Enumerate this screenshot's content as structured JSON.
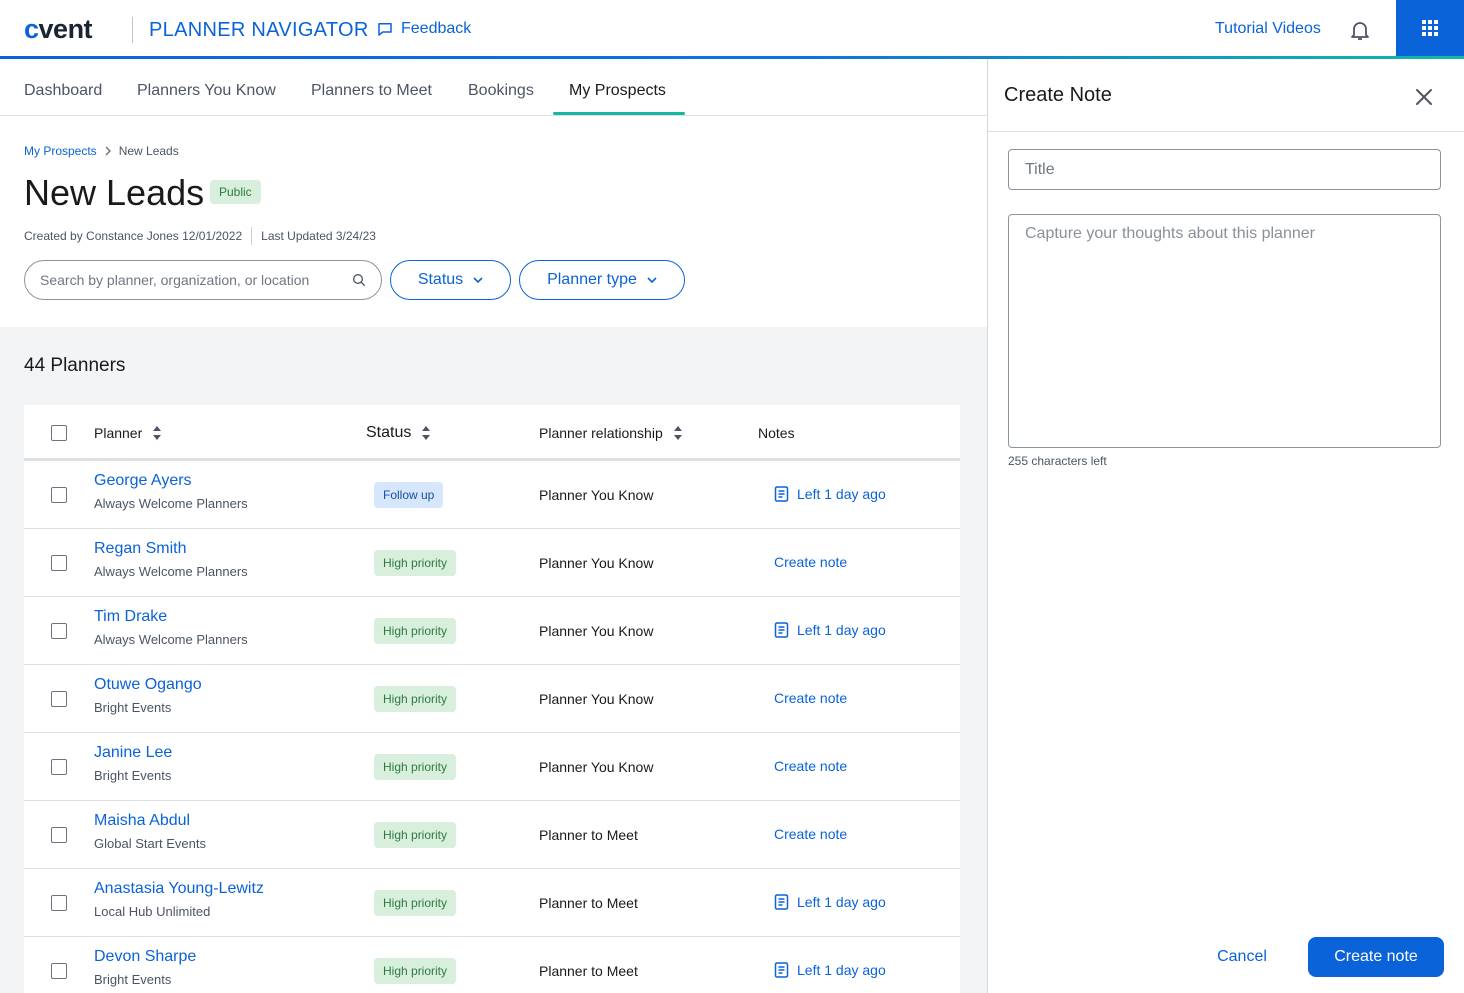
{
  "header": {
    "logo": "cvent",
    "app_title": "PLANNER NAVIGATOR",
    "feedback": "Feedback",
    "tutorial": "Tutorial Videos"
  },
  "tabs": [
    "Dashboard",
    "Planners You Know",
    "Planners to Meet",
    "Bookings",
    "My Prospects"
  ],
  "active_tab": "My Prospects",
  "breadcrumb": {
    "parent": "My Prospects",
    "current": "New Leads"
  },
  "page": {
    "title": "New Leads",
    "badge": "Public",
    "created": "Created by Constance Jones 12/01/2022",
    "updated": "Last Updated 3/24/23"
  },
  "filters": {
    "search_placeholder": "Search by planner, organization, or location",
    "status": "Status",
    "planner_type": "Planner type"
  },
  "list": {
    "count": "44 Planners",
    "columns": {
      "planner": "Planner",
      "status": "Status",
      "relationship": "Planner relationship",
      "notes": "Notes"
    },
    "rows": [
      {
        "name": "George Ayers",
        "org": "Always Welcome Planners",
        "status": "Follow up",
        "relationship": "Planner You Know",
        "note": "Left 1 day ago"
      },
      {
        "name": "Regan Smith",
        "org": "Always Welcome Planners",
        "status": "High priority",
        "relationship": "Planner You Know",
        "note": "Create note"
      },
      {
        "name": "Tim Drake",
        "org": "Always Welcome Planners",
        "status": "High priority",
        "relationship": "Planner You Know",
        "note": "Left 1 day ago"
      },
      {
        "name": "Otuwe Ogango",
        "org": "Bright Events",
        "status": "High priority",
        "relationship": "Planner You Know",
        "note": "Create note"
      },
      {
        "name": "Janine Lee",
        "org": "Bright Events",
        "status": "High priority",
        "relationship": "Planner You Know",
        "note": "Create note"
      },
      {
        "name": "Maisha Abdul",
        "org": "Global Start Events",
        "status": "High priority",
        "relationship": "Planner to Meet",
        "note": "Create note"
      },
      {
        "name": "Anastasia Young-Lewitz",
        "org": "Local Hub Unlimited",
        "status": "High priority",
        "relationship": "Planner to Meet",
        "note": "Left 1 day ago"
      },
      {
        "name": "Devon Sharpe",
        "org": "Bright Events",
        "status": "High priority",
        "relationship": "Planner to Meet",
        "note": "Left 1 day ago"
      }
    ]
  },
  "panel": {
    "title": "Create Note",
    "title_placeholder": "Title",
    "body_placeholder": "Capture your thoughts about this planner",
    "chars_left": "255 characters left",
    "cancel": "Cancel",
    "submit": "Create note"
  },
  "colors": {
    "brand": "#0a63d8",
    "accent": "#14b8a0",
    "status_high_bg": "#d7efdc",
    "status_follow_bg": "#d6e6fb"
  }
}
